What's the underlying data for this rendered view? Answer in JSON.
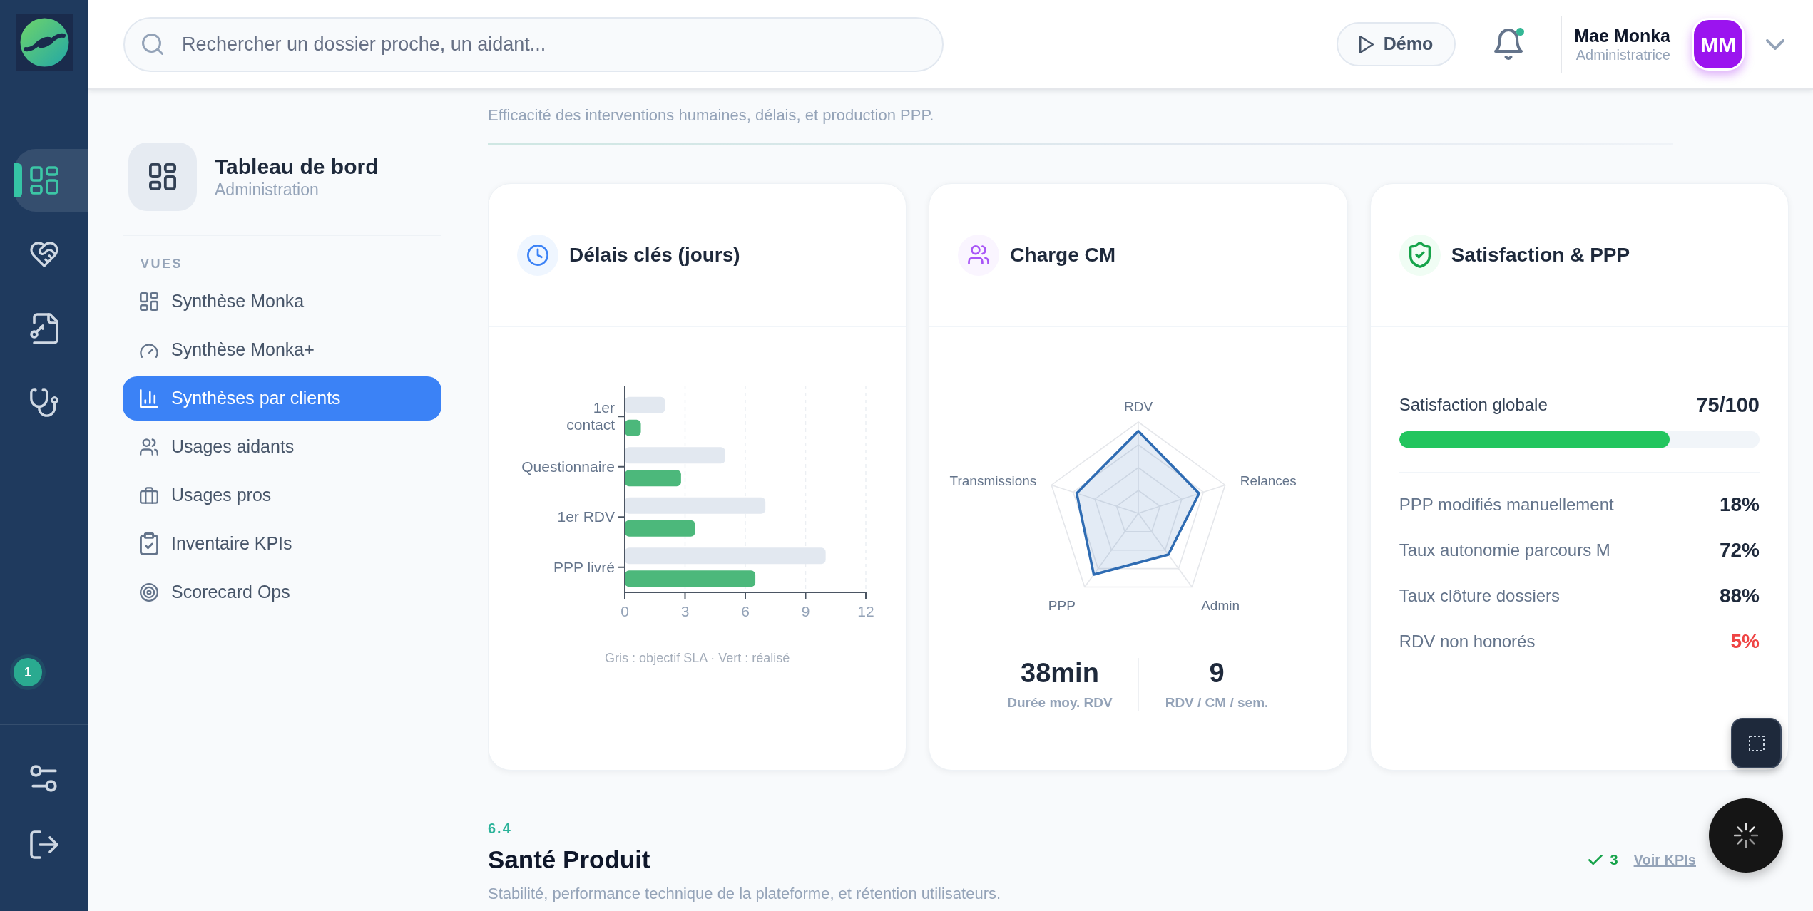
{
  "sidebar": {
    "items": [
      {
        "selected": true
      },
      {
        "selected": false
      },
      {
        "selected": false
      },
      {
        "selected": false
      }
    ],
    "badge": "1"
  },
  "header": {
    "search": {
      "placeholder": "Rechercher un dossier proche, un aidant..."
    },
    "demo_button": "Démo",
    "notifications": {
      "unread": true
    },
    "user": {
      "name": "Mae Monka",
      "role": "Administratrice",
      "initials": "MM"
    }
  },
  "nav_panel": {
    "title": "Tableau de bord",
    "subtitle": "Administration",
    "section_label": "VUES",
    "items": [
      {
        "label": "Synthèse Monka",
        "selected": false
      },
      {
        "label": "Synthèse Monka+",
        "selected": false
      },
      {
        "label": "Synthèses par clients",
        "selected": true
      },
      {
        "label": "Usages aidants",
        "selected": false
      },
      {
        "label": "Usages pros",
        "selected": false
      },
      {
        "label": "Inventaire KPIs",
        "selected": false
      },
      {
        "label": "Scorecard Ops",
        "selected": false
      }
    ]
  },
  "main": {
    "section_subtitle": "Efficacité des interventions humaines, délais, et production PPP.",
    "cards": [
      {
        "kind": "bar_chart",
        "title": "Délais clés (jours)",
        "chart_data": {
          "type": "bar",
          "orientation": "horizontal",
          "grid": true,
          "categories": [
            "1er contact",
            "Questionnaire",
            "1er RDV",
            "PPP livré"
          ],
          "series": [
            {
              "color": "#e2e8f0",
              "values": [
                2,
                5,
                7,
                10
              ]
            },
            {
              "color": "#4cb87b",
              "values": [
                0.8,
                2.8,
                3.5,
                6.5
              ]
            }
          ],
          "xlim": [
            0,
            12
          ],
          "xticks": [
            0,
            3,
            6,
            9,
            12
          ]
        },
        "caption": "Gris : objectif SLA · Vert : réalisé"
      },
      {
        "kind": "radar",
        "title": "Charge CM",
        "axes": [
          "RDV",
          "Relances",
          "Admin",
          "PPP",
          "Transmissions"
        ],
        "stats": [
          {
            "value": "38min",
            "label": "Durée moy. RDV"
          },
          {
            "value": "9",
            "label": "RDV / CM / sem."
          }
        ]
      },
      {
        "kind": "metrics",
        "title": "Satisfaction & PPP",
        "score": {
          "label": "Satisfaction globale",
          "value": "75/100",
          "level": 0.75
        },
        "rows": [
          {
            "label": "PPP modifiés manuellement",
            "value": "18%",
            "alert": false
          },
          {
            "label": "Taux autonomie parcours M",
            "value": "72%",
            "alert": false
          },
          {
            "label": "Taux clôture dossiers",
            "value": "88%",
            "alert": false
          },
          {
            "label": "RDV non honorés",
            "value": "5%",
            "alert": true
          }
        ]
      }
    ],
    "next_section": {
      "number": "6.4",
      "title": "Santé Produit",
      "subtitle": "Stabilité, performance technique de la plateforme, et rétention utilisateurs.",
      "check_count": "3",
      "link": "Voir KPIs"
    }
  }
}
